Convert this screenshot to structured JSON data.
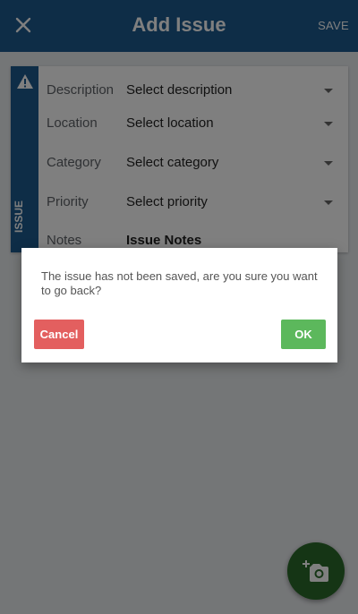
{
  "appbar": {
    "title": "Add Issue",
    "save_label": "SAVE",
    "close_icon": "close-icon"
  },
  "card": {
    "rail_label": "ISSUE",
    "warning_icon": "warning-icon",
    "fields": [
      {
        "label": "Description",
        "value": "Select description"
      },
      {
        "label": "Location",
        "value": "Select location"
      },
      {
        "label": "Category",
        "value": "Select category"
      },
      {
        "label": "Priority",
        "value": "Select priority"
      },
      {
        "label": "Notes",
        "value": "Issue Notes"
      }
    ]
  },
  "dialog": {
    "message": "The issue has not been saved, are you sure you want to go back?",
    "cancel_label": "Cancel",
    "ok_label": "OK"
  },
  "fab": {
    "icon": "add-photo-icon"
  },
  "colors": {
    "primary": "#1d5a8e",
    "cancel": "#e35f5f",
    "ok": "#5cb85c",
    "fab": "#2b6b2b"
  }
}
